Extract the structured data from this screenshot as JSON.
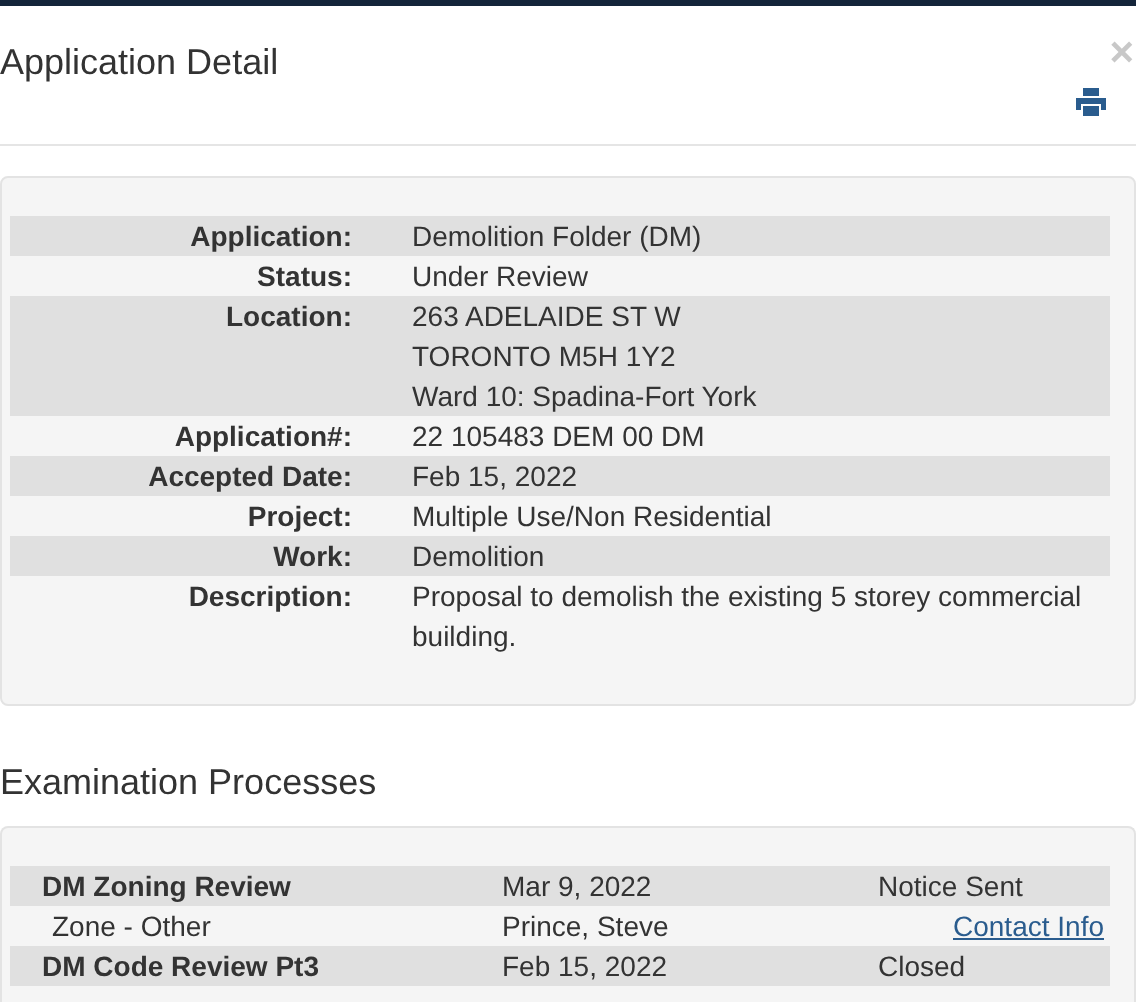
{
  "dialog": {
    "title": "Application Detail",
    "close": "×"
  },
  "details": [
    {
      "label": "Application:",
      "lines": [
        "Demolition Folder (DM)"
      ]
    },
    {
      "label": "Status:",
      "lines": [
        "Under Review"
      ]
    },
    {
      "label": "Location:",
      "lines": [
        "263 ADELAIDE ST W",
        "TORONTO M5H 1Y2",
        "Ward 10: Spadina-Fort York"
      ]
    },
    {
      "label": "Application#:",
      "lines": [
        "22 105483 DEM 00 DM"
      ]
    },
    {
      "label": "Accepted Date:",
      "lines": [
        "Feb 15, 2022"
      ]
    },
    {
      "label": "Project:",
      "lines": [
        "Multiple Use/Non Residential"
      ]
    },
    {
      "label": "Work:",
      "lines": [
        "Demolition"
      ]
    },
    {
      "label": "Description:",
      "lines": [
        "Proposal to demolish the existing 5 storey commercial building."
      ]
    }
  ],
  "examination": {
    "heading": "Examination Processes",
    "rows": [
      {
        "kind": "process",
        "name": "DM Zoning Review",
        "date": "Mar 9, 2022",
        "status": "Notice Sent"
      },
      {
        "kind": "contact",
        "name": "Zone - Other",
        "person": "Prince, Steve",
        "link": "Contact Info"
      },
      {
        "kind": "process",
        "name": "DM Code Review Pt3",
        "date": "Feb 15, 2022",
        "status": "Closed"
      }
    ]
  }
}
